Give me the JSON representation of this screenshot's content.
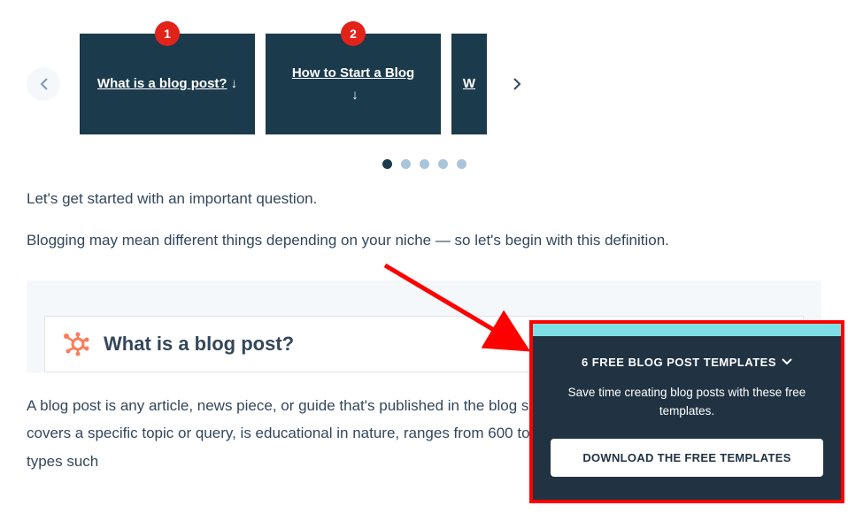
{
  "carousel": {
    "cards": [
      {
        "title": "What is a blog post?",
        "badge": "1"
      },
      {
        "title": "How to Start a Blog",
        "badge": "2"
      },
      {
        "title_partial": "W"
      }
    ],
    "dots_count": 5,
    "active_dot": 0
  },
  "intro": {
    "p1": "Let's get started with an important question.",
    "p2": "Blogging may mean different things depending on your niche — so let's begin with this definition."
  },
  "section": {
    "heading": "What is a blog post?",
    "body": "A blog post is any article, news piece, or guide that's published in the blog section of a website. A blog post typically covers a specific topic or query, is educational in nature, ranges from 600 to 2,000+ words, and contains other media types such"
  },
  "popup": {
    "title": "6 FREE BLOG POST TEMPLATES",
    "subtitle": "Save time creating blog posts with these free templates.",
    "button": "DOWNLOAD THE FREE TEMPLATES"
  }
}
